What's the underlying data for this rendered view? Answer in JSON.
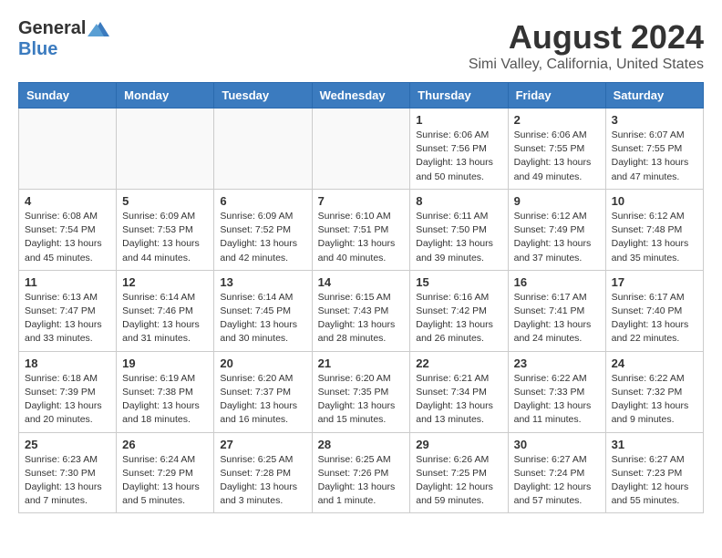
{
  "logo": {
    "general": "General",
    "blue": "Blue"
  },
  "title": "August 2024",
  "subtitle": "Simi Valley, California, United States",
  "days_header": [
    "Sunday",
    "Monday",
    "Tuesday",
    "Wednesday",
    "Thursday",
    "Friday",
    "Saturday"
  ],
  "weeks": [
    [
      {
        "day": "",
        "info": ""
      },
      {
        "day": "",
        "info": ""
      },
      {
        "day": "",
        "info": ""
      },
      {
        "day": "",
        "info": ""
      },
      {
        "day": "1",
        "info": "Sunrise: 6:06 AM\nSunset: 7:56 PM\nDaylight: 13 hours\nand 50 minutes."
      },
      {
        "day": "2",
        "info": "Sunrise: 6:06 AM\nSunset: 7:55 PM\nDaylight: 13 hours\nand 49 minutes."
      },
      {
        "day": "3",
        "info": "Sunrise: 6:07 AM\nSunset: 7:55 PM\nDaylight: 13 hours\nand 47 minutes."
      }
    ],
    [
      {
        "day": "4",
        "info": "Sunrise: 6:08 AM\nSunset: 7:54 PM\nDaylight: 13 hours\nand 45 minutes."
      },
      {
        "day": "5",
        "info": "Sunrise: 6:09 AM\nSunset: 7:53 PM\nDaylight: 13 hours\nand 44 minutes."
      },
      {
        "day": "6",
        "info": "Sunrise: 6:09 AM\nSunset: 7:52 PM\nDaylight: 13 hours\nand 42 minutes."
      },
      {
        "day": "7",
        "info": "Sunrise: 6:10 AM\nSunset: 7:51 PM\nDaylight: 13 hours\nand 40 minutes."
      },
      {
        "day": "8",
        "info": "Sunrise: 6:11 AM\nSunset: 7:50 PM\nDaylight: 13 hours\nand 39 minutes."
      },
      {
        "day": "9",
        "info": "Sunrise: 6:12 AM\nSunset: 7:49 PM\nDaylight: 13 hours\nand 37 minutes."
      },
      {
        "day": "10",
        "info": "Sunrise: 6:12 AM\nSunset: 7:48 PM\nDaylight: 13 hours\nand 35 minutes."
      }
    ],
    [
      {
        "day": "11",
        "info": "Sunrise: 6:13 AM\nSunset: 7:47 PM\nDaylight: 13 hours\nand 33 minutes."
      },
      {
        "day": "12",
        "info": "Sunrise: 6:14 AM\nSunset: 7:46 PM\nDaylight: 13 hours\nand 31 minutes."
      },
      {
        "day": "13",
        "info": "Sunrise: 6:14 AM\nSunset: 7:45 PM\nDaylight: 13 hours\nand 30 minutes."
      },
      {
        "day": "14",
        "info": "Sunrise: 6:15 AM\nSunset: 7:43 PM\nDaylight: 13 hours\nand 28 minutes."
      },
      {
        "day": "15",
        "info": "Sunrise: 6:16 AM\nSunset: 7:42 PM\nDaylight: 13 hours\nand 26 minutes."
      },
      {
        "day": "16",
        "info": "Sunrise: 6:17 AM\nSunset: 7:41 PM\nDaylight: 13 hours\nand 24 minutes."
      },
      {
        "day": "17",
        "info": "Sunrise: 6:17 AM\nSunset: 7:40 PM\nDaylight: 13 hours\nand 22 minutes."
      }
    ],
    [
      {
        "day": "18",
        "info": "Sunrise: 6:18 AM\nSunset: 7:39 PM\nDaylight: 13 hours\nand 20 minutes."
      },
      {
        "day": "19",
        "info": "Sunrise: 6:19 AM\nSunset: 7:38 PM\nDaylight: 13 hours\nand 18 minutes."
      },
      {
        "day": "20",
        "info": "Sunrise: 6:20 AM\nSunset: 7:37 PM\nDaylight: 13 hours\nand 16 minutes."
      },
      {
        "day": "21",
        "info": "Sunrise: 6:20 AM\nSunset: 7:35 PM\nDaylight: 13 hours\nand 15 minutes."
      },
      {
        "day": "22",
        "info": "Sunrise: 6:21 AM\nSunset: 7:34 PM\nDaylight: 13 hours\nand 13 minutes."
      },
      {
        "day": "23",
        "info": "Sunrise: 6:22 AM\nSunset: 7:33 PM\nDaylight: 13 hours\nand 11 minutes."
      },
      {
        "day": "24",
        "info": "Sunrise: 6:22 AM\nSunset: 7:32 PM\nDaylight: 13 hours\nand 9 minutes."
      }
    ],
    [
      {
        "day": "25",
        "info": "Sunrise: 6:23 AM\nSunset: 7:30 PM\nDaylight: 13 hours\nand 7 minutes."
      },
      {
        "day": "26",
        "info": "Sunrise: 6:24 AM\nSunset: 7:29 PM\nDaylight: 13 hours\nand 5 minutes."
      },
      {
        "day": "27",
        "info": "Sunrise: 6:25 AM\nSunset: 7:28 PM\nDaylight: 13 hours\nand 3 minutes."
      },
      {
        "day": "28",
        "info": "Sunrise: 6:25 AM\nSunset: 7:26 PM\nDaylight: 13 hours\nand 1 minute."
      },
      {
        "day": "29",
        "info": "Sunrise: 6:26 AM\nSunset: 7:25 PM\nDaylight: 12 hours\nand 59 minutes."
      },
      {
        "day": "30",
        "info": "Sunrise: 6:27 AM\nSunset: 7:24 PM\nDaylight: 12 hours\nand 57 minutes."
      },
      {
        "day": "31",
        "info": "Sunrise: 6:27 AM\nSunset: 7:23 PM\nDaylight: 12 hours\nand 55 minutes."
      }
    ]
  ]
}
